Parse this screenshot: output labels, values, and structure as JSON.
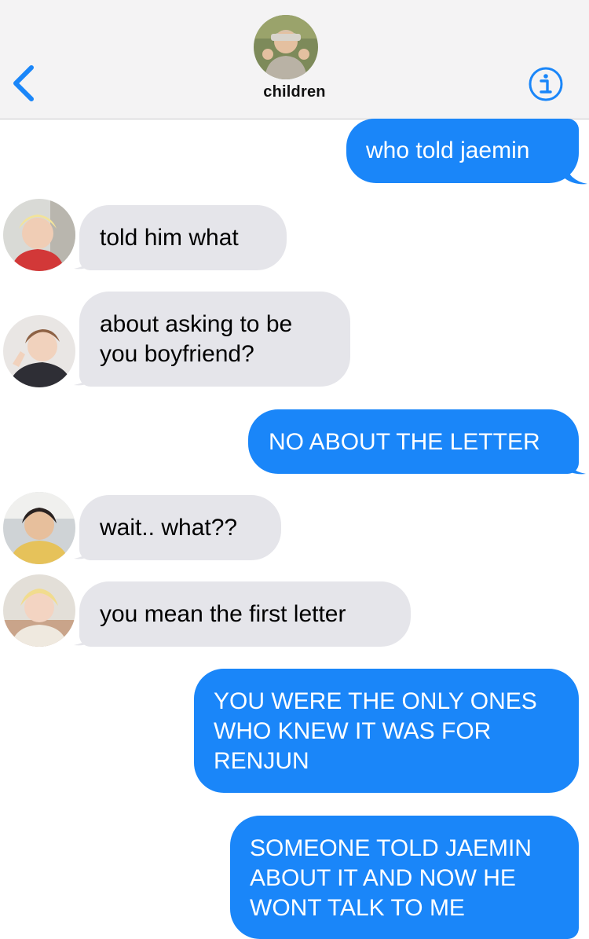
{
  "header": {
    "title": "children",
    "back_icon": "chevron-left-icon",
    "info_icon": "info-circle-icon"
  },
  "colors": {
    "outgoing_bubble": "#1a86f9",
    "incoming_bubble": "#e5e5ea",
    "accent": "#1a86f9"
  },
  "messages": [
    {
      "direction": "outgoing",
      "text": "who told jaemin"
    },
    {
      "direction": "incoming",
      "text": "told him what"
    },
    {
      "direction": "incoming",
      "text": "about asking to be\nyou boyfriend?"
    },
    {
      "direction": "outgoing",
      "text": "NO ABOUT THE LETTER"
    },
    {
      "direction": "incoming",
      "text": "wait.. what??"
    },
    {
      "direction": "incoming",
      "text": "you mean the first letter"
    },
    {
      "direction": "outgoing",
      "text": "YOU WERE THE ONLY ONES\nWHO KNEW IT WAS FOR\nRENJUN"
    },
    {
      "direction": "outgoing",
      "text": "SOMEONE TOLD JAEMIN\nABOUT IT AND NOW HE\nWONT TALK TO ME"
    }
  ]
}
